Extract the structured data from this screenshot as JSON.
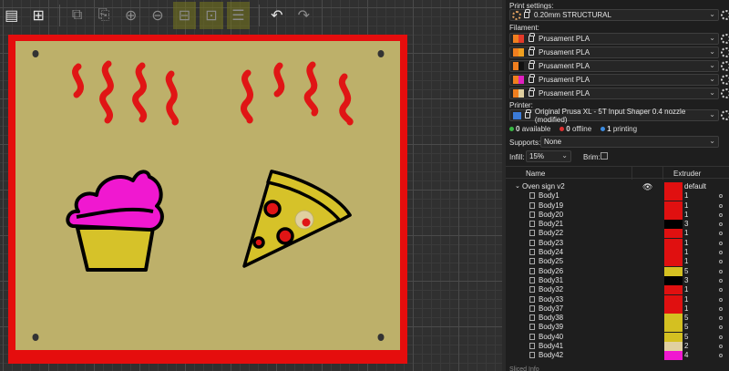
{
  "toolbar": {
    "buttons": [
      {
        "name": "arrange-icon",
        "glyph": "▤",
        "active": true
      },
      {
        "name": "arrange-selection-icon",
        "glyph": "⊞",
        "active": true
      },
      {
        "name": "copy-icon",
        "glyph": "⧉",
        "active": false
      },
      {
        "name": "paste-icon",
        "glyph": "⎘",
        "active": false
      },
      {
        "name": "add-instance-icon",
        "glyph": "⊕",
        "active": false
      },
      {
        "name": "remove-instance-icon",
        "glyph": "⊖",
        "active": false
      },
      {
        "name": "split-objects-icon",
        "glyph": "⊟",
        "active": false
      },
      {
        "name": "split-parts-icon",
        "glyph": "⊡",
        "active": false
      },
      {
        "name": "layers-icon",
        "glyph": "☰",
        "active": false
      },
      {
        "name": "undo-icon",
        "glyph": "↶",
        "active": true
      },
      {
        "name": "redo-icon",
        "glyph": "↷",
        "active": false
      }
    ]
  },
  "sidebar": {
    "print_settings_label": "Print settings:",
    "print_settings_value": "0.20mm STRUCTURAL",
    "filament_label": "Filament:",
    "filaments": [
      {
        "name": "Prusament PLA",
        "colors": [
          "#f07f1f",
          "#e33a2a"
        ]
      },
      {
        "name": "Prusament PLA",
        "colors": [
          "#f07f1f",
          "#f0a020"
        ]
      },
      {
        "name": "Prusament PLA",
        "colors": [
          "#f07f1f",
          "#111111"
        ]
      },
      {
        "name": "Prusament PLA",
        "colors": [
          "#f07f1f",
          "#e020c0"
        ]
      },
      {
        "name": "Prusament PLA",
        "colors": [
          "#f07f1f",
          "#e0d0a0"
        ]
      }
    ],
    "printer_label": "Printer:",
    "printer_value": "Original Prusa XL - 5T Input Shaper 0.4 nozzle (modified)",
    "status": {
      "available": "0",
      "available_label": "available",
      "offline": "0",
      "offline_label": "offline",
      "printing": "1",
      "printing_label": "printing"
    },
    "supports_label": "Supports:",
    "supports_value": "None",
    "infill_label": "Infill:",
    "infill_value": "15%",
    "brim_label": "Brim:",
    "list": {
      "col_name": "Name",
      "col_extruder": "Extruder",
      "group": {
        "name": "Oven sign v2",
        "extruder": "default",
        "color": "#e01010"
      },
      "rows": [
        {
          "name": "Body1",
          "extruder": "1",
          "color": "#e01010"
        },
        {
          "name": "Body19",
          "extruder": "1",
          "color": "#e01010"
        },
        {
          "name": "Body20",
          "extruder": "1",
          "color": "#e01010"
        },
        {
          "name": "Body21",
          "extruder": "3",
          "color": "#000000"
        },
        {
          "name": "Body22",
          "extruder": "1",
          "color": "#e01010"
        },
        {
          "name": "Body23",
          "extruder": "1",
          "color": "#e01010"
        },
        {
          "name": "Body24",
          "extruder": "1",
          "color": "#e01010"
        },
        {
          "name": "Body25",
          "extruder": "1",
          "color": "#e01010"
        },
        {
          "name": "Body26",
          "extruder": "5",
          "color": "#d4c021"
        },
        {
          "name": "Body31",
          "extruder": "3",
          "color": "#000000"
        },
        {
          "name": "Body32",
          "extruder": "1",
          "color": "#e01010"
        },
        {
          "name": "Body33",
          "extruder": "1",
          "color": "#e01010"
        },
        {
          "name": "Body37",
          "extruder": "1",
          "color": "#e01010"
        },
        {
          "name": "Body38",
          "extruder": "5",
          "color": "#d4c021"
        },
        {
          "name": "Body39",
          "extruder": "5",
          "color": "#d4c021"
        },
        {
          "name": "Body40",
          "extruder": "5",
          "color": "#d4c021"
        },
        {
          "name": "Body41",
          "extruder": "2",
          "color": "#e0d0a0"
        },
        {
          "name": "Body42",
          "extruder": "4",
          "color": "#f018d0"
        }
      ]
    }
  }
}
